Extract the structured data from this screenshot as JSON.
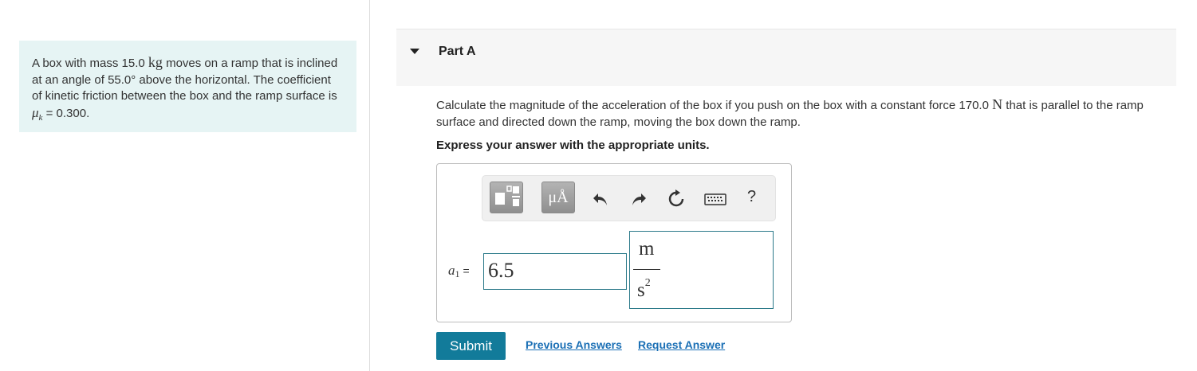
{
  "problem": {
    "text_1": "A box with mass 15.0 ",
    "mass_unit": "kg",
    "text_2": " moves on a ramp that is inclined at an angle of 55.0° above the horizontal. The coefficient of kinetic friction between the box and the ramp surface is ",
    "mu_symbol": "μ",
    "mu_subscript": "k",
    "text_3": " = 0.300."
  },
  "part": {
    "title": "Part A",
    "question_1": "Calculate the magnitude of the acceleration of the box if you push on the box with a constant force 170.0 ",
    "force_unit": "N",
    "question_2": " that is parallel to the ramp surface and directed down the ramp, moving the box down the ramp.",
    "instruction": "Express your answer with the appropriate units."
  },
  "toolbar": {
    "units_label": "μÅ",
    "help_label": "?",
    "icons": [
      "templates-icon",
      "units-icon",
      "undo-icon",
      "redo-icon",
      "reset-icon",
      "keyboard-icon",
      "help-icon"
    ]
  },
  "answer": {
    "var_symbol": "a",
    "var_subscript": "1",
    "equals": "=",
    "value": "6.5",
    "unit_numerator": "m",
    "unit_denominator": "s",
    "unit_power": "2"
  },
  "actions": {
    "submit_label": "Submit",
    "previous_answers_label": "Previous Answers",
    "request_answer_label": "Request Answer"
  },
  "colors": {
    "problem_bg": "#e6f4f4",
    "accent": "#127b9a",
    "link": "#1a6fb5",
    "input_border": "#2c7a8a"
  }
}
